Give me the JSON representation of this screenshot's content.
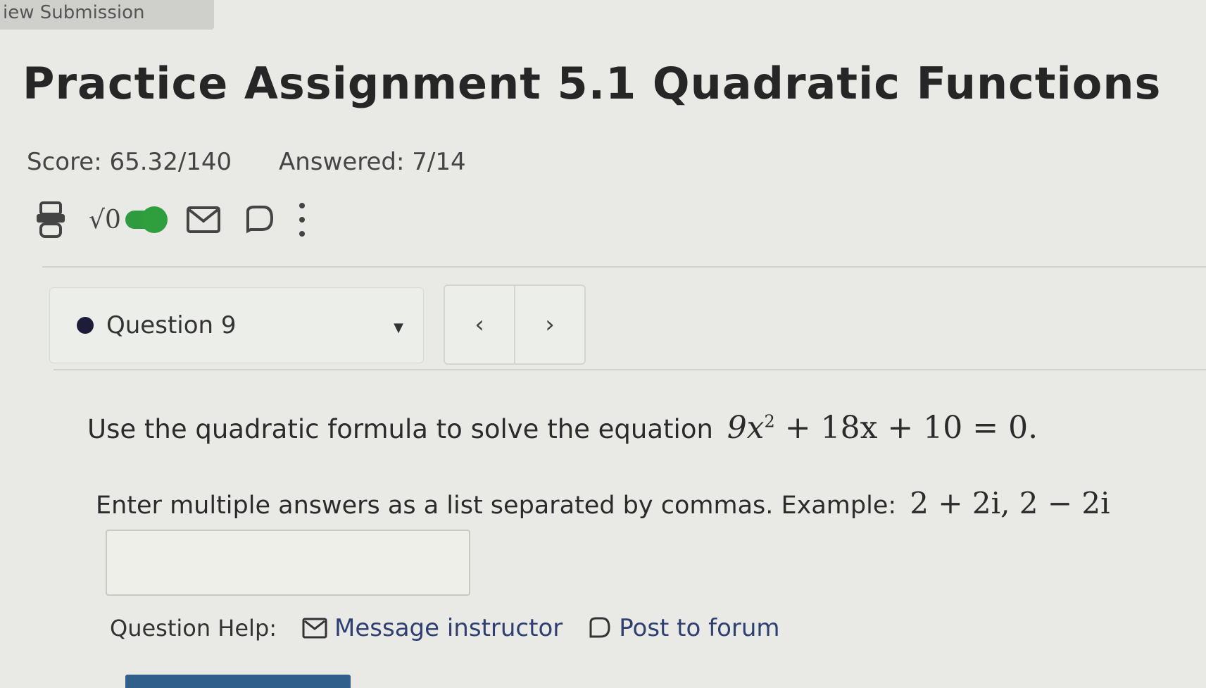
{
  "top_tab": {
    "label": "iew Submission"
  },
  "assignment": {
    "title": "Practice Assignment 5.1 Quadratic Functions",
    "score": "Score: 65.32/140",
    "answered": "Answered: 7/14"
  },
  "toolbar": {
    "icons": [
      "print-icon",
      "sqrt-icon",
      "math-toggle",
      "message-icon",
      "comment-icon",
      "more-vertical-icon"
    ],
    "sqrt_symbol": "√0",
    "toggle_color": "#2e9b3f"
  },
  "question_nav": {
    "selected": "Question 9",
    "prev_symbol": "‹",
    "next_symbol": "›"
  },
  "question": {
    "prompt": "Use the quadratic formula to solve the equation",
    "equation_a": "9x",
    "equation_exp": "2",
    "equation_b": " + 18x + 10 = 0.",
    "instructions": "Enter multiple answers as a list separated by commas. Example:",
    "example": "2 + 2i, 2 − 2i",
    "answer_value": ""
  },
  "help": {
    "label": "Question Help:",
    "message_link": "Message instructor",
    "forum_link": "Post to forum"
  },
  "colors": {
    "background": "#e9eae5",
    "link": "#2f3f72",
    "accent_bar": "#2f5f8a"
  }
}
